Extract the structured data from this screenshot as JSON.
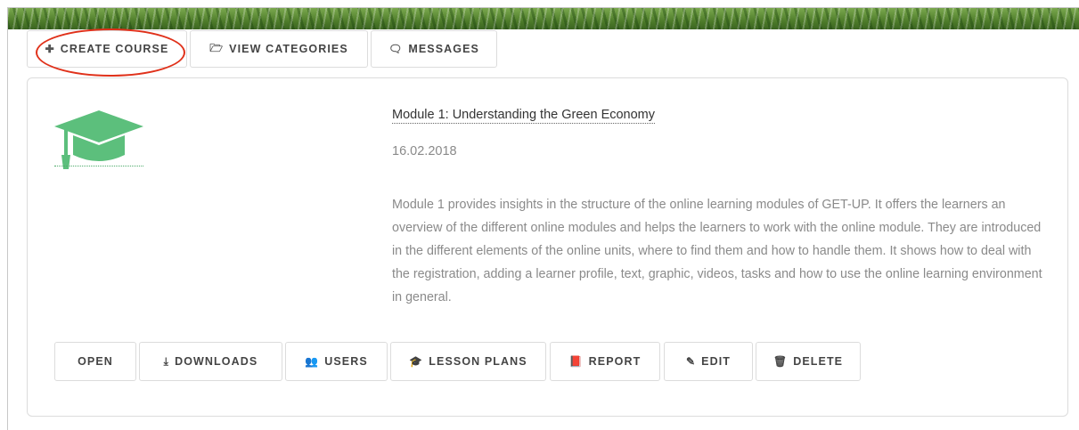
{
  "tabs": [
    {
      "label": "CREATE COURSE",
      "icon": "plus-icon",
      "glyph": "✚"
    },
    {
      "label": "VIEW CATEGORIES",
      "icon": "folder-open-icon",
      "glyph": "🗁"
    },
    {
      "label": "MESSAGES",
      "icon": "chat-bubble-icon",
      "glyph": "🗨"
    }
  ],
  "course": {
    "title": "Module 1: Understanding the Green Economy",
    "date": "16.02.2018",
    "description": "Module 1 provides insights in the structure of the online learning modules of GET-UP. It offers the learners an overview of the different online modules and helps the learners to work with the online module. They are introduced in the different elements of the online units, where to find them and how to handle them. It shows how to deal with the registration, adding a learner profile, text, graphic, videos, tasks and how to use the online learning environment in general.",
    "icon": "graduation-cap-icon",
    "icon_color": "#5cbf7c"
  },
  "actions": [
    {
      "label": "OPEN",
      "icon": "",
      "glyph": ""
    },
    {
      "label": "DOWNLOADS",
      "icon": "download-icon",
      "glyph": "⤓"
    },
    {
      "label": "USERS",
      "icon": "users-icon",
      "glyph": "👥"
    },
    {
      "label": "LESSON PLANS",
      "icon": "graduation-cap-icon",
      "glyph": "🎓"
    },
    {
      "label": "REPORT",
      "icon": "book-icon",
      "glyph": "📕"
    },
    {
      "label": "EDIT",
      "icon": "pencil-icon",
      "glyph": "✎"
    },
    {
      "label": "DELETE",
      "icon": "trash-icon",
      "glyph": "🗑"
    }
  ],
  "colors": {
    "highlight_circle": "#e0311a",
    "border": "#dcdcdc"
  }
}
